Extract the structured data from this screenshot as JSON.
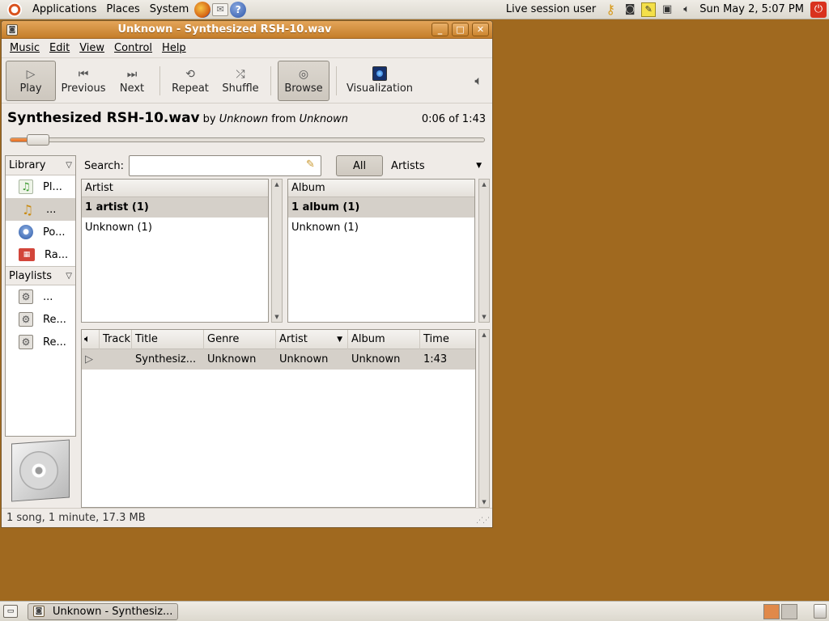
{
  "top_panel": {
    "menus": [
      "Applications",
      "Places",
      "System"
    ],
    "session_user": "Live session user",
    "clock": "Sun May  2,  5:07 PM"
  },
  "window": {
    "title": "Unknown - Synthesized RSH-10.wav",
    "menus": [
      "Music",
      "Edit",
      "View",
      "Control",
      "Help"
    ],
    "toolbar": {
      "play": "Play",
      "previous": "Previous",
      "next": "Next",
      "repeat": "Repeat",
      "shuffle": "Shuffle",
      "browse": "Browse",
      "visualization": "Visualization"
    },
    "now_playing": {
      "title": "Synthesized RSH-10.wav",
      "by": "by",
      "artist": "Unknown",
      "from": "from",
      "album": "Unknown",
      "time": "0:06 of 1:43",
      "elapsed_seconds": 6,
      "total_seconds": 103
    },
    "sidebar": {
      "library_header": "Library",
      "library_items": [
        "Pl...",
        "...",
        "Po...",
        "Ra..."
      ],
      "playlists_header": "Playlists",
      "playlist_items": [
        "...",
        "Re...",
        "Re..."
      ]
    },
    "search": {
      "label": "Search:",
      "value": "",
      "all_button": "All",
      "filter_selected": "Artists"
    },
    "artist_pane": {
      "header": "Artist",
      "rows": [
        "1 artist (1)",
        "Unknown (1)"
      ]
    },
    "album_pane": {
      "header": "Album",
      "rows": [
        "1 album (1)",
        "Unknown (1)"
      ]
    },
    "tracks": {
      "columns": [
        "Track",
        "Title",
        "Genre",
        "Artist",
        "Album",
        "Time"
      ],
      "rows": [
        {
          "track": "",
          "title": "Synthesiz...",
          "genre": "Unknown",
          "artist": "Unknown",
          "album": "Unknown",
          "time": "1:43"
        }
      ]
    },
    "status": "1 song, 1 minute, 17.3 MB"
  },
  "bottom_panel": {
    "task_label": "Unknown - Synthesiz..."
  },
  "colors": {
    "desktop": "#a0691f",
    "titlebar": "#d48f3e",
    "progress": "#e46a1e"
  }
}
